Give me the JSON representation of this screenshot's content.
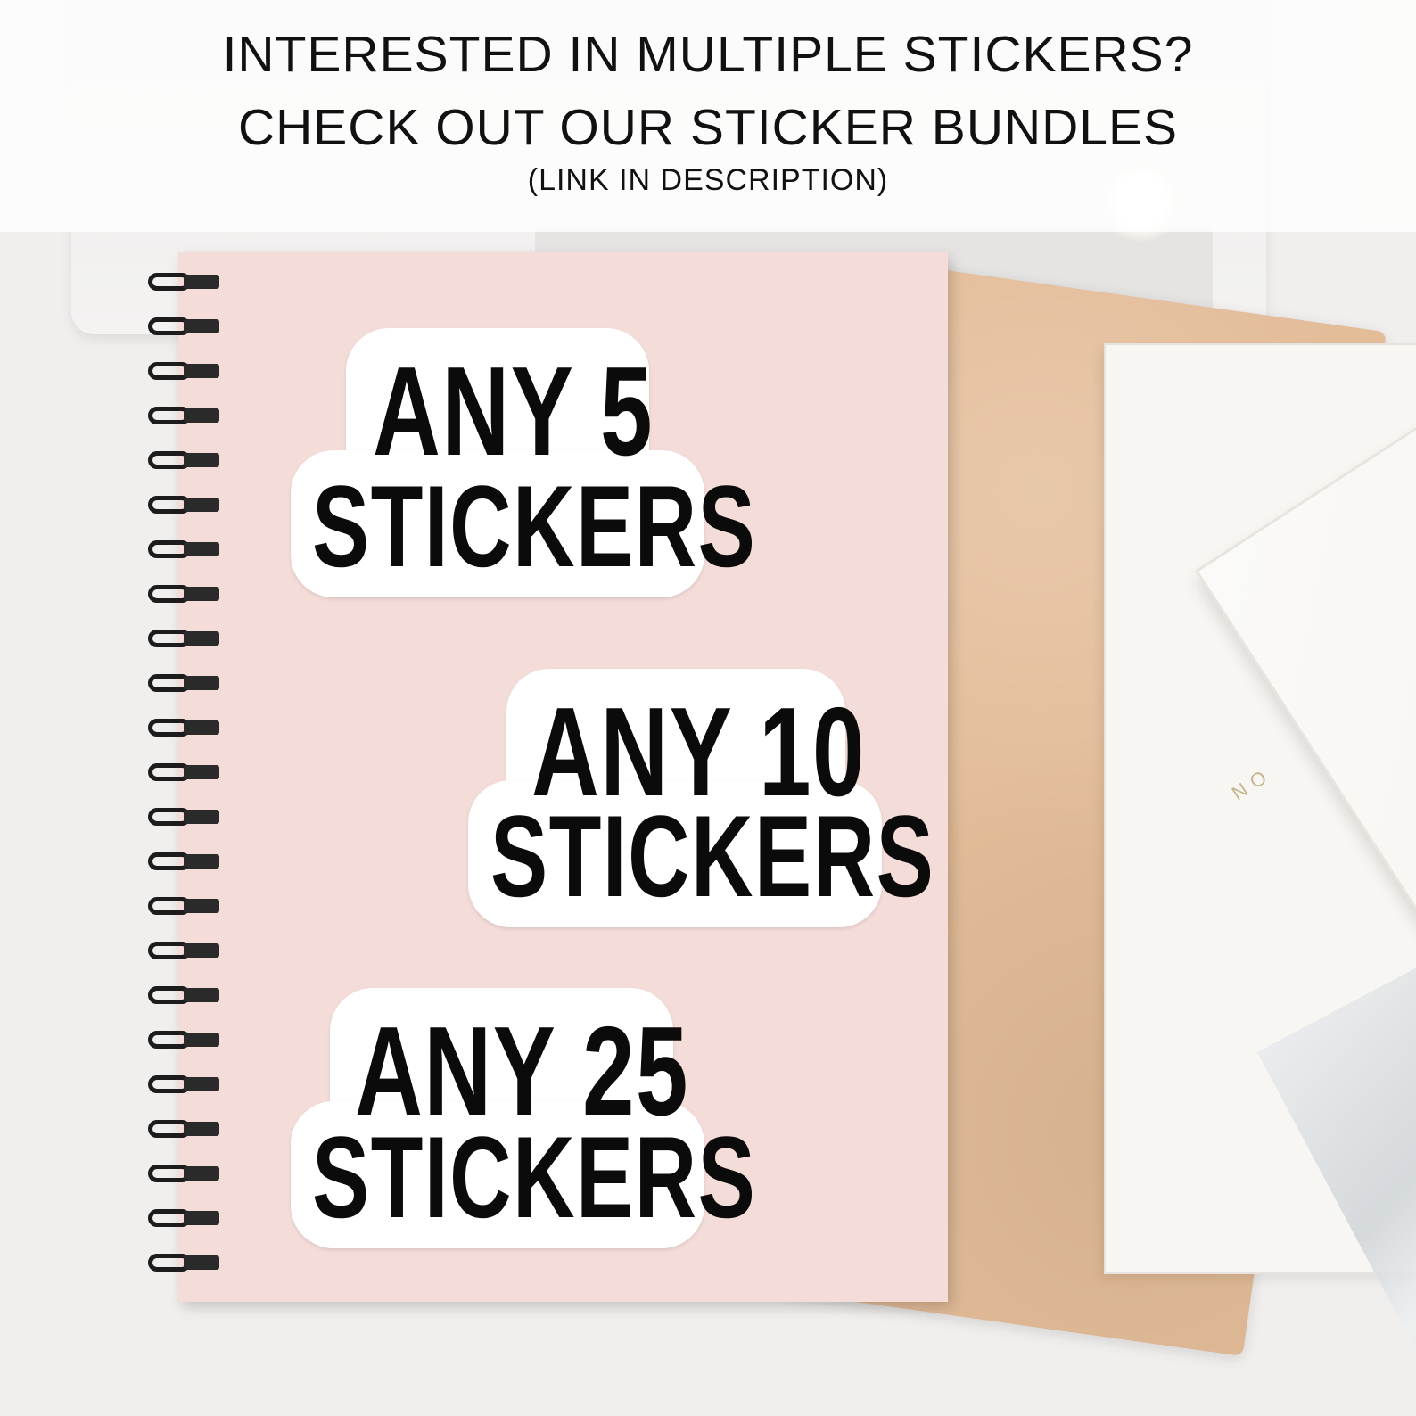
{
  "header": {
    "line1": "INTERESTED IN MULTIPLE STICKERS?",
    "line2": "CHECK OUT OUR STICKER BUNDLES",
    "line3": "(LINK IN DESCRIPTION)"
  },
  "background_book_text": "NO",
  "stickers": [
    {
      "line1": "ANY 5",
      "line2": "STICKERS"
    },
    {
      "line1": "ANY 10",
      "line2": "STICKERS"
    },
    {
      "line1": "ANY 25",
      "line2": "STICKERS"
    }
  ],
  "colors": {
    "notebook": "#f4dcd9",
    "sticker_fill": "#ffffff",
    "sticker_text": "#0b0b0b",
    "leather": "#e3bc98",
    "spiral": "#1c1c1c"
  }
}
